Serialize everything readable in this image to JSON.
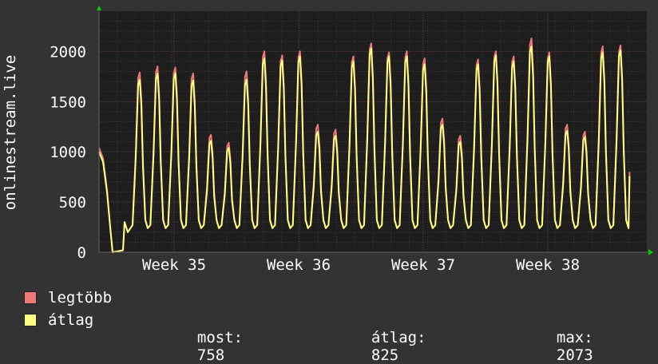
{
  "chart_data": {
    "type": "line",
    "ylabel": "onlinestream.live",
    "ylim": [
      0,
      2400
    ],
    "ytick_labels": [
      "0",
      "500",
      "1000",
      "1500",
      "2000"
    ],
    "yticks": [
      0,
      500,
      1000,
      1500,
      2000
    ],
    "x_tick_labels": [
      "Week 35",
      "Week 36",
      "Week 37",
      "Week 38"
    ],
    "grid": true,
    "colors": {
      "background": "#333333",
      "plot_bg": "#1e1e1e",
      "grid": "#5a3a3a",
      "max_series": "#f07878",
      "avg_series": "#ffff80",
      "arrow": "#00cc00"
    },
    "series": [
      {
        "name": "legtöbb",
        "daily_peaks": [
          1790,
          1850,
          1840,
          1780,
          1170,
          1090,
          1800,
          2000,
          1960,
          2000,
          1270,
          1220,
          1950,
          2080,
          1990,
          2000,
          1930,
          1330,
          1160,
          1920,
          2000,
          1950,
          2130,
          1990,
          1270,
          1200,
          2050,
          2060
        ]
      },
      {
        "name": "átlag",
        "daily_peaks": [
          1720,
          1780,
          1780,
          1710,
          1110,
          1040,
          1720,
          1930,
          1910,
          1950,
          1200,
          1160,
          1900,
          2030,
          1950,
          1950,
          1870,
          1270,
          1100,
          1870,
          1960,
          1900,
          2050,
          1950,
          1210,
          1150,
          1990,
          2010
        ]
      }
    ],
    "summary": {
      "current_label": "most:",
      "current_value": "758",
      "average_label": "átlag:",
      "average_value": "825",
      "max_label": "max:",
      "max_value": "2073"
    }
  },
  "legend": [
    {
      "label": "legtöbb",
      "color": "#f07878"
    },
    {
      "label": "átlag",
      "color": "#ffff80"
    }
  ]
}
